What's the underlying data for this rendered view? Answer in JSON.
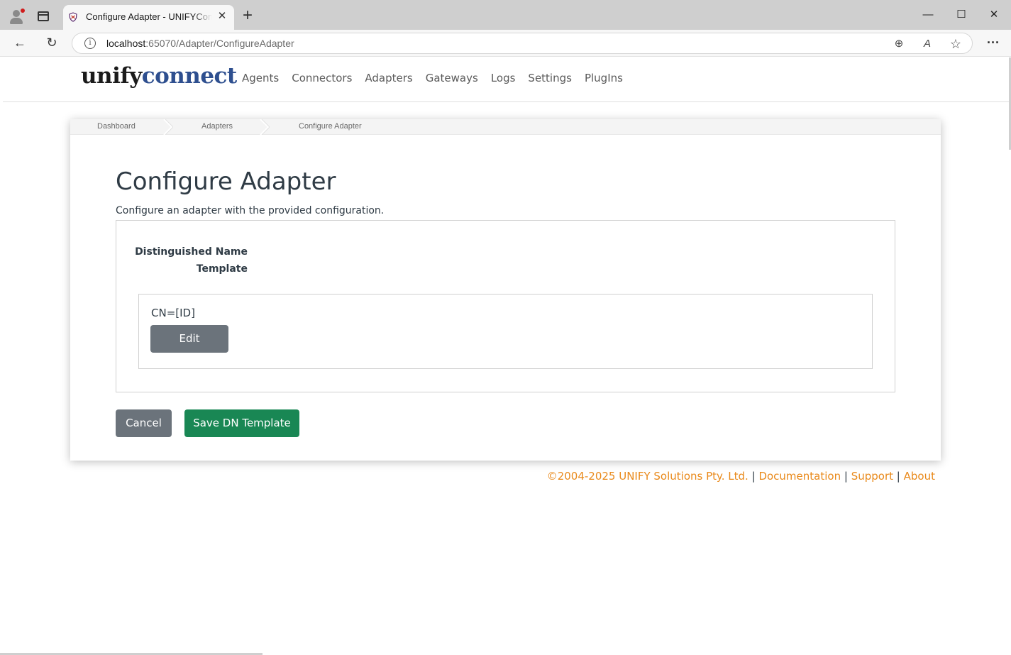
{
  "browser": {
    "tab_title": "Configure Adapter - UNIFYConnect",
    "tab_close": "✕",
    "new_tab": "+",
    "url_host": "localhost",
    "url_rest": ":65070/Adapter/ConfigureAdapter",
    "info_glyph": "i",
    "back_glyph": "←",
    "reload_glyph": "↻",
    "zoom_glyph": "⊕",
    "read_glyph": "A",
    "favorite_glyph": "☆",
    "menu_glyph": "···",
    "minimize_glyph": "—",
    "maximize_glyph": "☐",
    "close_glyph": "✕"
  },
  "header": {
    "logo_part1": "unify",
    "logo_part2": "connect",
    "nav": [
      "Agents",
      "Connectors",
      "Adapters",
      "Gateways",
      "Logs",
      "Settings",
      "PlugIns"
    ]
  },
  "breadcrumb": [
    "Dashboard",
    "Adapters",
    "Configure Adapter"
  ],
  "main": {
    "title": "Configure Adapter",
    "description": "Configure an adapter with the provided configuration.",
    "field_label_line1": "Distinguished Name",
    "field_label_line2": "Template",
    "dn_template_value": "CN=[ID]",
    "edit_label": "Edit",
    "cancel_label": "Cancel",
    "save_label": "Save DN Template"
  },
  "footer": {
    "copyright": "©2004-2025 UNIFY Solutions Pty. Ltd.",
    "separator": "|",
    "documentation": "Documentation",
    "support": "Support",
    "about": "About"
  },
  "colors": {
    "accent_link": "#e9891a",
    "save_button": "#198754",
    "secondary_button": "#6b737b",
    "logo_blue": "#2e4f8f"
  }
}
